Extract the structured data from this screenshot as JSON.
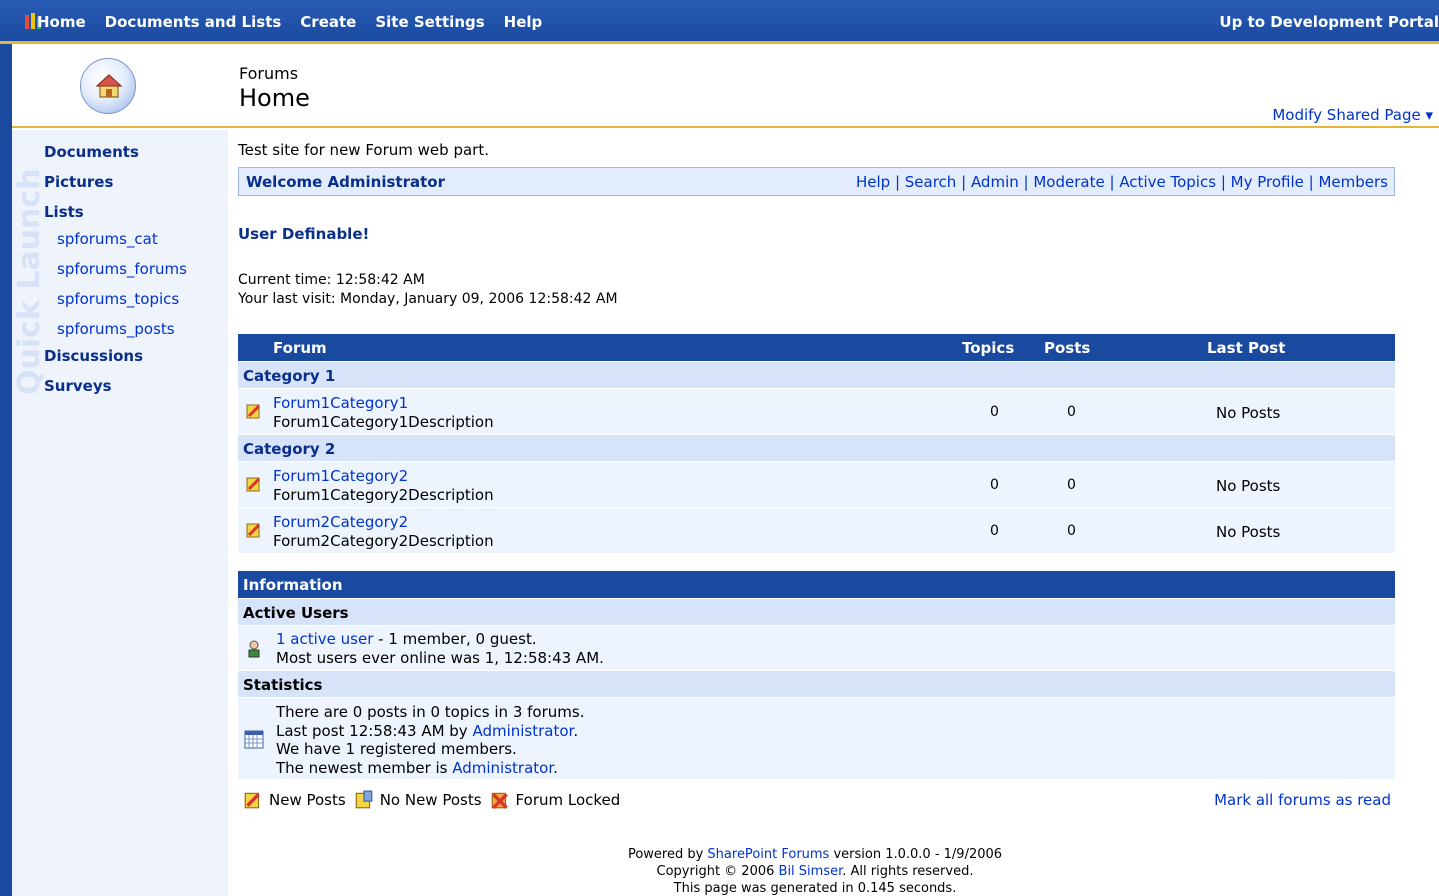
{
  "topnav": {
    "items": [
      "Home",
      "Documents and Lists",
      "Create",
      "Site Settings",
      "Help"
    ],
    "portal_link": "Up to Development Portal"
  },
  "header": {
    "crumb": "Forums",
    "title": "Home",
    "modify": "Modify Shared Page ▾"
  },
  "quick_launch": {
    "watermark": "Quick Launch",
    "documents": "Documents",
    "pictures": "Pictures",
    "lists": "Lists",
    "list_items": [
      "spforums_cat",
      "spforums_forums",
      "spforums_topics",
      "spforums_posts"
    ],
    "discussions": "Discussions",
    "surveys": "Surveys"
  },
  "main": {
    "description": "Test site for new Forum web part.",
    "welcome": "Welcome Administrator",
    "links": [
      "Help",
      "Search",
      "Admin",
      "Moderate",
      "Active Topics",
      "My Profile",
      "Members"
    ],
    "user_definable": "User Definable!",
    "current_time": "Current time: 12:58:42 AM",
    "last_visit": "Your last visit: Monday, January 09, 2006 12:58:42 AM"
  },
  "forum_table": {
    "headers": {
      "forum": "Forum",
      "topics": "Topics",
      "posts": "Posts",
      "last_post": "Last Post"
    },
    "categories": [
      {
        "name": "Category 1",
        "forums": [
          {
            "name": "Forum1Category1",
            "description": "Forum1Category1Description",
            "topics": "0",
            "posts": "0",
            "last_post": "No Posts"
          }
        ]
      },
      {
        "name": "Category 2",
        "forums": [
          {
            "name": "Forum1Category2",
            "description": "Forum1Category2Description",
            "topics": "0",
            "posts": "0",
            "last_post": "No Posts"
          },
          {
            "name": "Forum2Category2",
            "description": "Forum2Category2Description",
            "topics": "0",
            "posts": "0",
            "last_post": "No Posts"
          }
        ]
      }
    ]
  },
  "info": {
    "title": "Information",
    "active_users_title": "Active Users",
    "active_link": "1 active user",
    "active_rest": " - 1 member, 0 guest.",
    "most_users": "Most users ever online was 1, 12:58:43 AM.",
    "statistics_title": "Statistics",
    "stats_line1": "There are 0 posts in 0 topics in 3 forums.",
    "stats_line2_pre": "Last post 12:58:43 AM by ",
    "stats_line2_link": "Administrator",
    "stats_line2_post": ".",
    "stats_line3": "We have 1 registered members.",
    "stats_line4_pre": "The newest member is ",
    "stats_line4_link": "Administrator",
    "stats_line4_post": "."
  },
  "legend": {
    "new_posts": "New Posts",
    "no_new_posts": "No New Posts",
    "forum_locked": "Forum Locked",
    "mark_all": "Mark all forums as read"
  },
  "footer": {
    "line1_pre": "Powered by ",
    "line1_link": "SharePoint Forums",
    "line1_post": " version 1.0.0.0 - 1/9/2006",
    "line2_pre": "Copyright © 2006 ",
    "line2_link": "Bil Simser",
    "line2_post": ". All rights reserved.",
    "line3": "This page was generated in 0.145 seconds."
  },
  "colors": {
    "topbar": "#1a4aa0",
    "accent_gold": "#e8b53a",
    "link": "#0033cc",
    "category_bg": "#d6e3f8",
    "row_bg": "#eef4fd"
  }
}
